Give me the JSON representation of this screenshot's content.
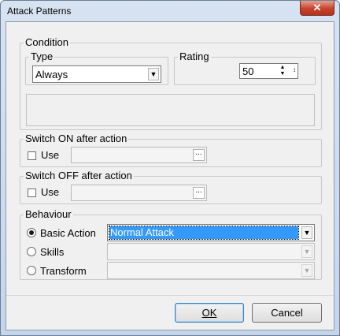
{
  "window": {
    "title": "Attack Patterns",
    "close_glyph": "✕"
  },
  "condition": {
    "legend": "Condition",
    "type": {
      "legend": "Type",
      "value": "Always"
    },
    "rating": {
      "legend": "Rating",
      "value": "50"
    }
  },
  "switch_on": {
    "legend": "Switch ON after action",
    "use_label": "Use",
    "checked": false
  },
  "switch_off": {
    "legend": "Switch OFF after action",
    "use_label": "Use",
    "checked": false
  },
  "behaviour": {
    "legend": "Behaviour",
    "options": [
      {
        "label": "Basic Action",
        "selected": true,
        "value": "Normal Attack"
      },
      {
        "label": "Skills",
        "selected": false,
        "value": ""
      },
      {
        "label": "Transform",
        "selected": false,
        "value": ""
      }
    ]
  },
  "buttons": {
    "ok": "OK",
    "cancel": "Cancel"
  },
  "icons": {
    "dropdown": "▼",
    "spin_up": "▲",
    "spin_down": "▼",
    "browse": "...",
    "resize": "↕"
  }
}
